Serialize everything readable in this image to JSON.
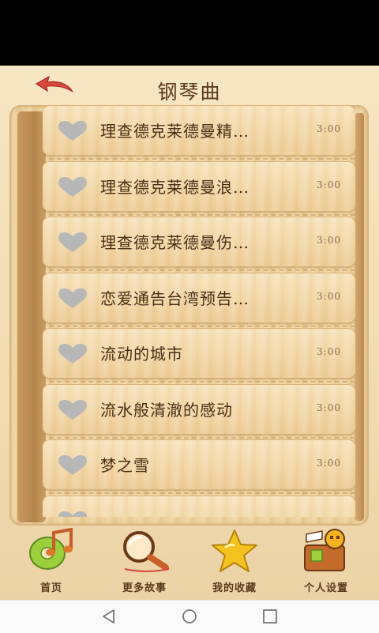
{
  "header": {
    "title": "钢琴曲",
    "back_icon": "back-arrow-icon"
  },
  "songs": [
    {
      "title": "理查德克莱德曼精…",
      "duration": "3:00",
      "icon": "heart-icon"
    },
    {
      "title": "理查德克莱德曼浪…",
      "duration": "3:00",
      "icon": "heart-icon"
    },
    {
      "title": "理查德克莱德曼伤…",
      "duration": "3:00",
      "icon": "heart-icon"
    },
    {
      "title": "恋爱通告台湾预告…",
      "duration": "3:00",
      "icon": "heart-icon"
    },
    {
      "title": "流动的城市",
      "duration": "3:00",
      "icon": "heart-icon"
    },
    {
      "title": "流水般清澈的感动",
      "duration": "3:00",
      "icon": "heart-icon"
    },
    {
      "title": "梦之雪",
      "duration": "3:00",
      "icon": "heart-icon"
    },
    {
      "title": "",
      "duration": "",
      "icon": "heart-icon"
    }
  ],
  "tabs": [
    {
      "label": "首页",
      "icon": "home-music-icon"
    },
    {
      "label": "更多故事",
      "icon": "magnifier-icon"
    },
    {
      "label": "我的收藏",
      "icon": "star-icon"
    },
    {
      "label": "个人设置",
      "icon": "settings-character-icon"
    }
  ],
  "system_nav": {
    "back": "nav-back-icon",
    "home": "nav-home-icon",
    "recents": "nav-recents-icon"
  },
  "colors": {
    "heart": "#b7b7b7",
    "title_text": "#5a3a1c",
    "back_arrow": "#d9483b",
    "star": "#f4c21f"
  }
}
